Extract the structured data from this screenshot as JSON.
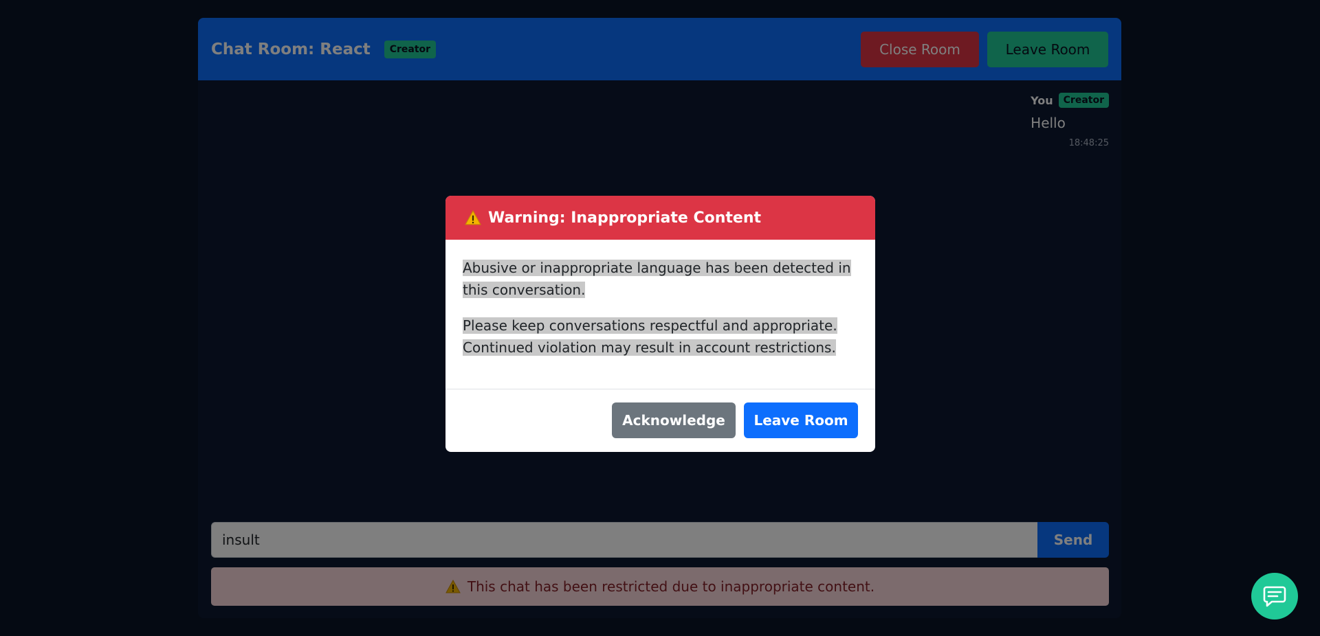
{
  "header": {
    "title": "Chat Room: React",
    "role_badge": "Creator",
    "close_room_label": "Close Room",
    "leave_room_label": "Leave Room"
  },
  "messages": [
    {
      "sender": "You",
      "badge": "Creator",
      "text": "Hello",
      "time": "18:48:25"
    }
  ],
  "composer": {
    "value": "insult",
    "send_label": "Send"
  },
  "restriction_notice": "This chat has been restricted due to inappropriate content.",
  "modal": {
    "title": "Warning: Inappropriate Content",
    "paragraph_1": "Abusive or inappropriate language has been detected in this conversation.",
    "paragraph_2": "Please keep conversations respectful and appropriate. Continued violation may result in account restrictions.",
    "acknowledge_label": "Acknowledge",
    "leave_room_label": "Leave Room"
  },
  "icons": {
    "warning": "warning-icon",
    "chat": "chat-bubble-icon"
  },
  "colors": {
    "header": "#0d6efd",
    "danger": "#dc3545",
    "success": "#20c997",
    "secondary": "#6c757d",
    "primary": "#0d6efd"
  }
}
